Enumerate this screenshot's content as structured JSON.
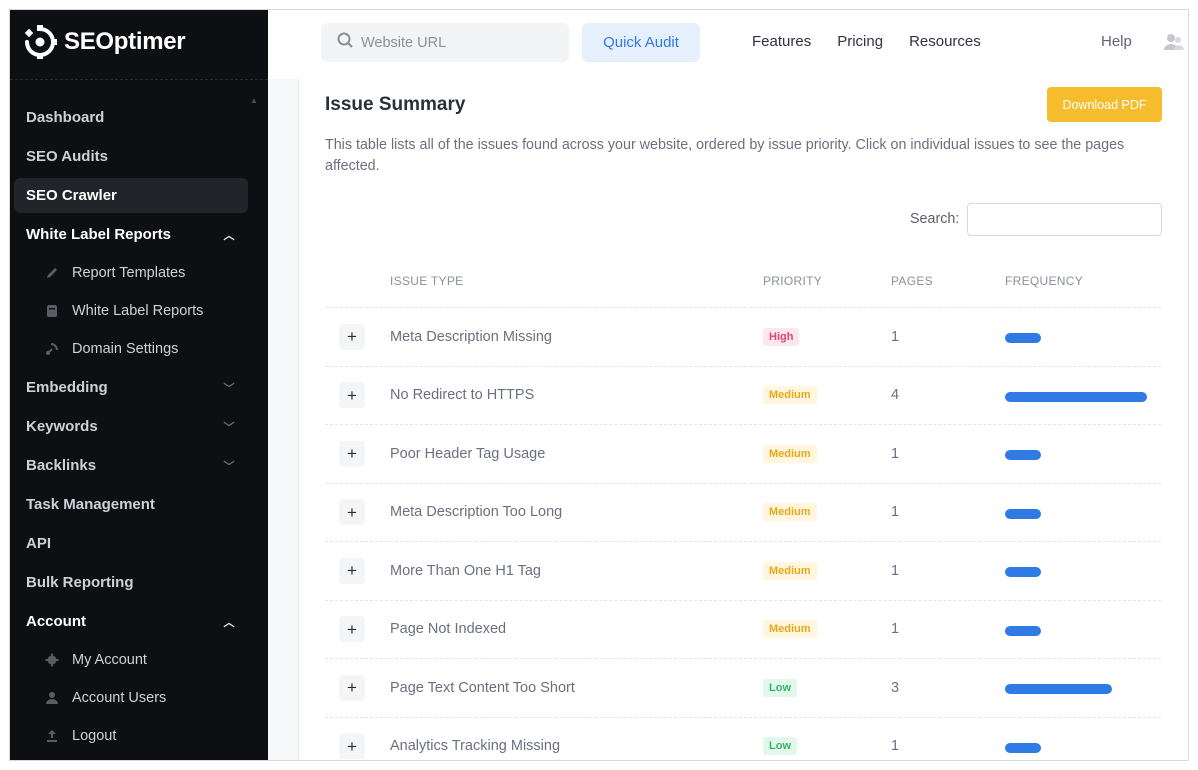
{
  "brand": {
    "name": "SEOptimer"
  },
  "sidebar": {
    "items": [
      {
        "label": "Dashboard"
      },
      {
        "label": "SEO Audits"
      },
      {
        "label": "SEO Crawler"
      },
      {
        "label": "White Label Reports"
      },
      {
        "label": "Report Templates"
      },
      {
        "label": "White Label Reports"
      },
      {
        "label": "Domain Settings"
      },
      {
        "label": "Embedding"
      },
      {
        "label": "Keywords"
      },
      {
        "label": "Backlinks"
      },
      {
        "label": "Task Management"
      },
      {
        "label": "API"
      },
      {
        "label": "Bulk Reporting"
      },
      {
        "label": "Account"
      },
      {
        "label": "My Account"
      },
      {
        "label": "Account Users"
      },
      {
        "label": "Logout"
      }
    ]
  },
  "topbar": {
    "search_placeholder": "Website URL",
    "quick_audit": "Quick Audit",
    "links": [
      "Features",
      "Pricing",
      "Resources"
    ],
    "help": "Help"
  },
  "main": {
    "title": "Issue Summary",
    "download_pdf": "Download PDF",
    "description": "This table lists all of the issues found across your website, ordered by issue priority. Click on individual issues to see the pages affected.",
    "search_label": "Search:",
    "columns": [
      "ISSUE TYPE",
      "PRIORITY",
      "PAGES",
      "FREQUENCY"
    ],
    "rows": [
      {
        "issue": "Meta Description Missing",
        "priority": "High",
        "pages": "1",
        "frequency": 0.25
      },
      {
        "issue": "No Redirect to HTTPS",
        "priority": "Medium",
        "pages": "4",
        "frequency": 1.0
      },
      {
        "issue": "Poor Header Tag Usage",
        "priority": "Medium",
        "pages": "1",
        "frequency": 0.25
      },
      {
        "issue": "Meta Description Too Long",
        "priority": "Medium",
        "pages": "1",
        "frequency": 0.25
      },
      {
        "issue": "More Than One H1 Tag",
        "priority": "Medium",
        "pages": "1",
        "frequency": 0.25
      },
      {
        "issue": "Page Not Indexed",
        "priority": "Medium",
        "pages": "1",
        "frequency": 0.25
      },
      {
        "issue": "Page Text Content Too Short",
        "priority": "Low",
        "pages": "3",
        "frequency": 0.75
      },
      {
        "issue": "Analytics Tracking Missing",
        "priority": "Low",
        "pages": "1",
        "frequency": 0.25
      }
    ]
  },
  "colors": {
    "accent": "#2f7ae5",
    "pdf_button": "#f5bd2c",
    "sidebar_bg": "#0e0f12"
  }
}
